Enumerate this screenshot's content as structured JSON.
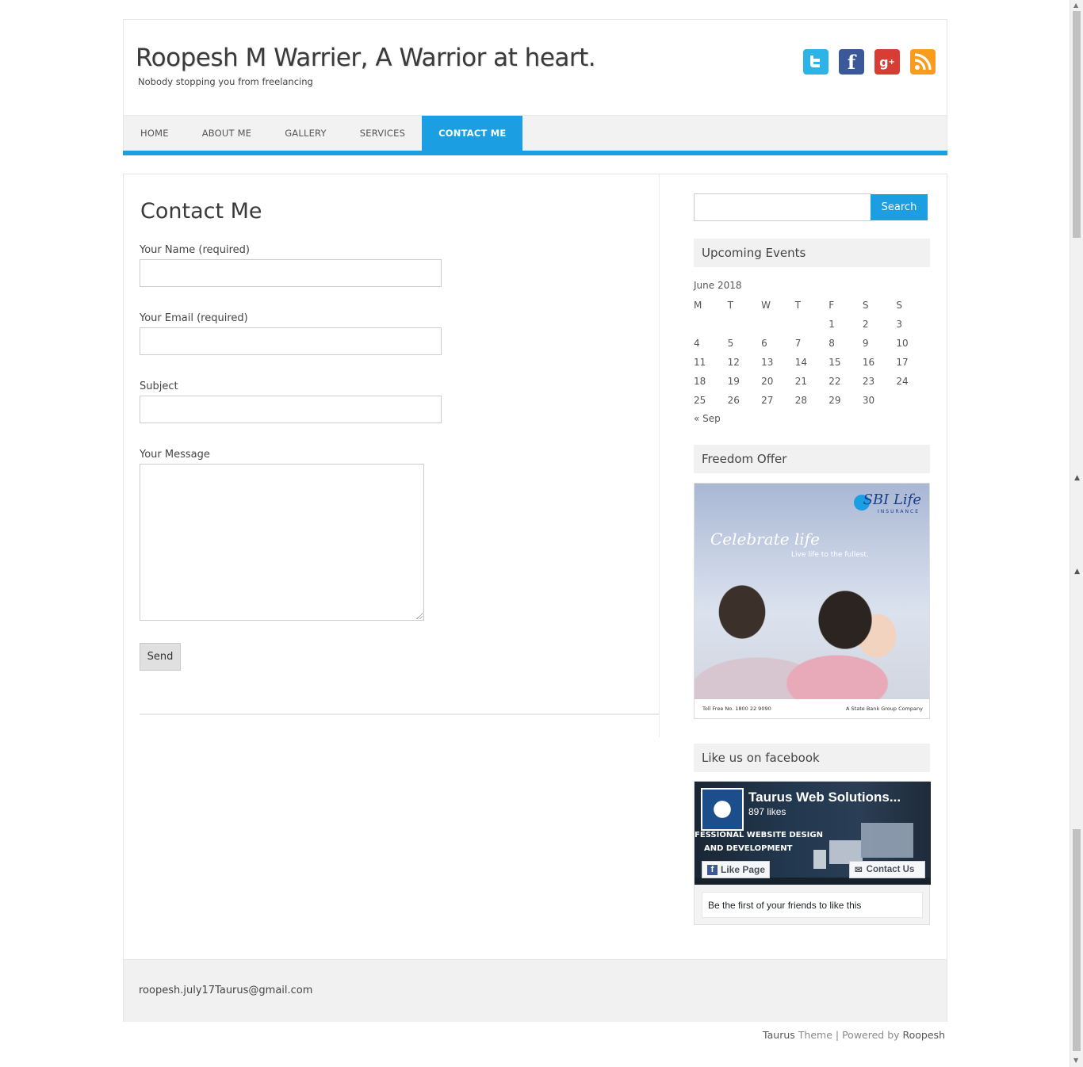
{
  "header": {
    "title": "Roopesh M Warrier, A Warrior at heart.",
    "tagline": "Nobody stopping you from freelancing",
    "social": [
      "twitter-icon",
      "facebook-icon",
      "google-plus-icon",
      "rss-icon"
    ]
  },
  "nav": {
    "items": [
      "HOME",
      "ABOUT ME",
      "GALLERY",
      "SERVICES",
      "CONTACT ME"
    ],
    "active": "CONTACT ME"
  },
  "page": {
    "title": "Contact Me",
    "fields": {
      "name_label": "Your Name (required)",
      "email_label": "Your Email (required)",
      "subject_label": "Subject",
      "message_label": "Your Message"
    },
    "send_label": "Send"
  },
  "sidebar": {
    "search_label": "Search",
    "events": {
      "title": "Upcoming Events",
      "month": "June 2018",
      "days": [
        "M",
        "T",
        "W",
        "T",
        "F",
        "S",
        "S"
      ],
      "weeks": [
        [
          "",
          "",
          "",
          "",
          "1",
          "2",
          "3"
        ],
        [
          "4",
          "5",
          "6",
          "7",
          "8",
          "9",
          "10"
        ],
        [
          "11",
          "12",
          "13",
          "14",
          "15",
          "16",
          "17"
        ],
        [
          "18",
          "19",
          "20",
          "21",
          "22",
          "23",
          "24"
        ],
        [
          "25",
          "26",
          "27",
          "28",
          "29",
          "30",
          ""
        ]
      ],
      "prev": "« Sep"
    },
    "offer": {
      "title": "Freedom Offer",
      "brand": "SBI Life",
      "brand_sub": "INSURANCE",
      "headline": "Celebrate life",
      "tagline": "Live life to the fullest.",
      "toll_free": "Toll Free No. 1800 22 9090",
      "group": "A State Bank Group Company"
    },
    "facebook": {
      "title": "Like us on facebook",
      "page_name": "Taurus Web Solutions...",
      "likes": "897 likes",
      "promo_line1": "FESSIONAL WEBSITE DESIGN",
      "promo_line2": "AND DEVELOPMENT",
      "like_button": "Like Page",
      "contact_button": "Contact Us",
      "friends_text": "Be the first of your friends to like this"
    }
  },
  "footer": {
    "email": "roopesh.july17Taurus@gmail.com",
    "theme_name": "Taurus",
    "theme_word": "Theme",
    "separator": "|",
    "powered_by": "Powered by",
    "author": "Roopesh"
  },
  "colors": {
    "accent": "#1b9ee2",
    "twitter": "#2cb4e8",
    "facebook": "#3b5998",
    "google_plus": "#d73d32",
    "rss": "#f99b1c"
  }
}
